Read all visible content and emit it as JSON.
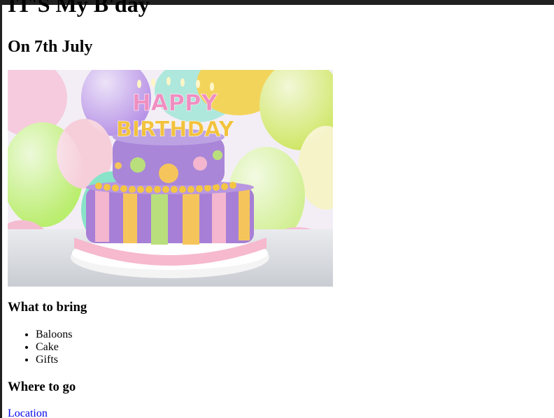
{
  "header": {
    "title": "IT'S My B'day",
    "subtitle": "On 7th July"
  },
  "image": {
    "cake_letters_top": "HAPPY",
    "cake_letters_bottom": "BIRTHDAY"
  },
  "bring": {
    "heading": "What to bring",
    "items": [
      "Baloons",
      "Cake",
      "Gifts"
    ]
  },
  "where": {
    "heading": "Where to go",
    "link_label": "Location"
  },
  "colors": {
    "link": "#0000ee",
    "frame": "#202020"
  }
}
